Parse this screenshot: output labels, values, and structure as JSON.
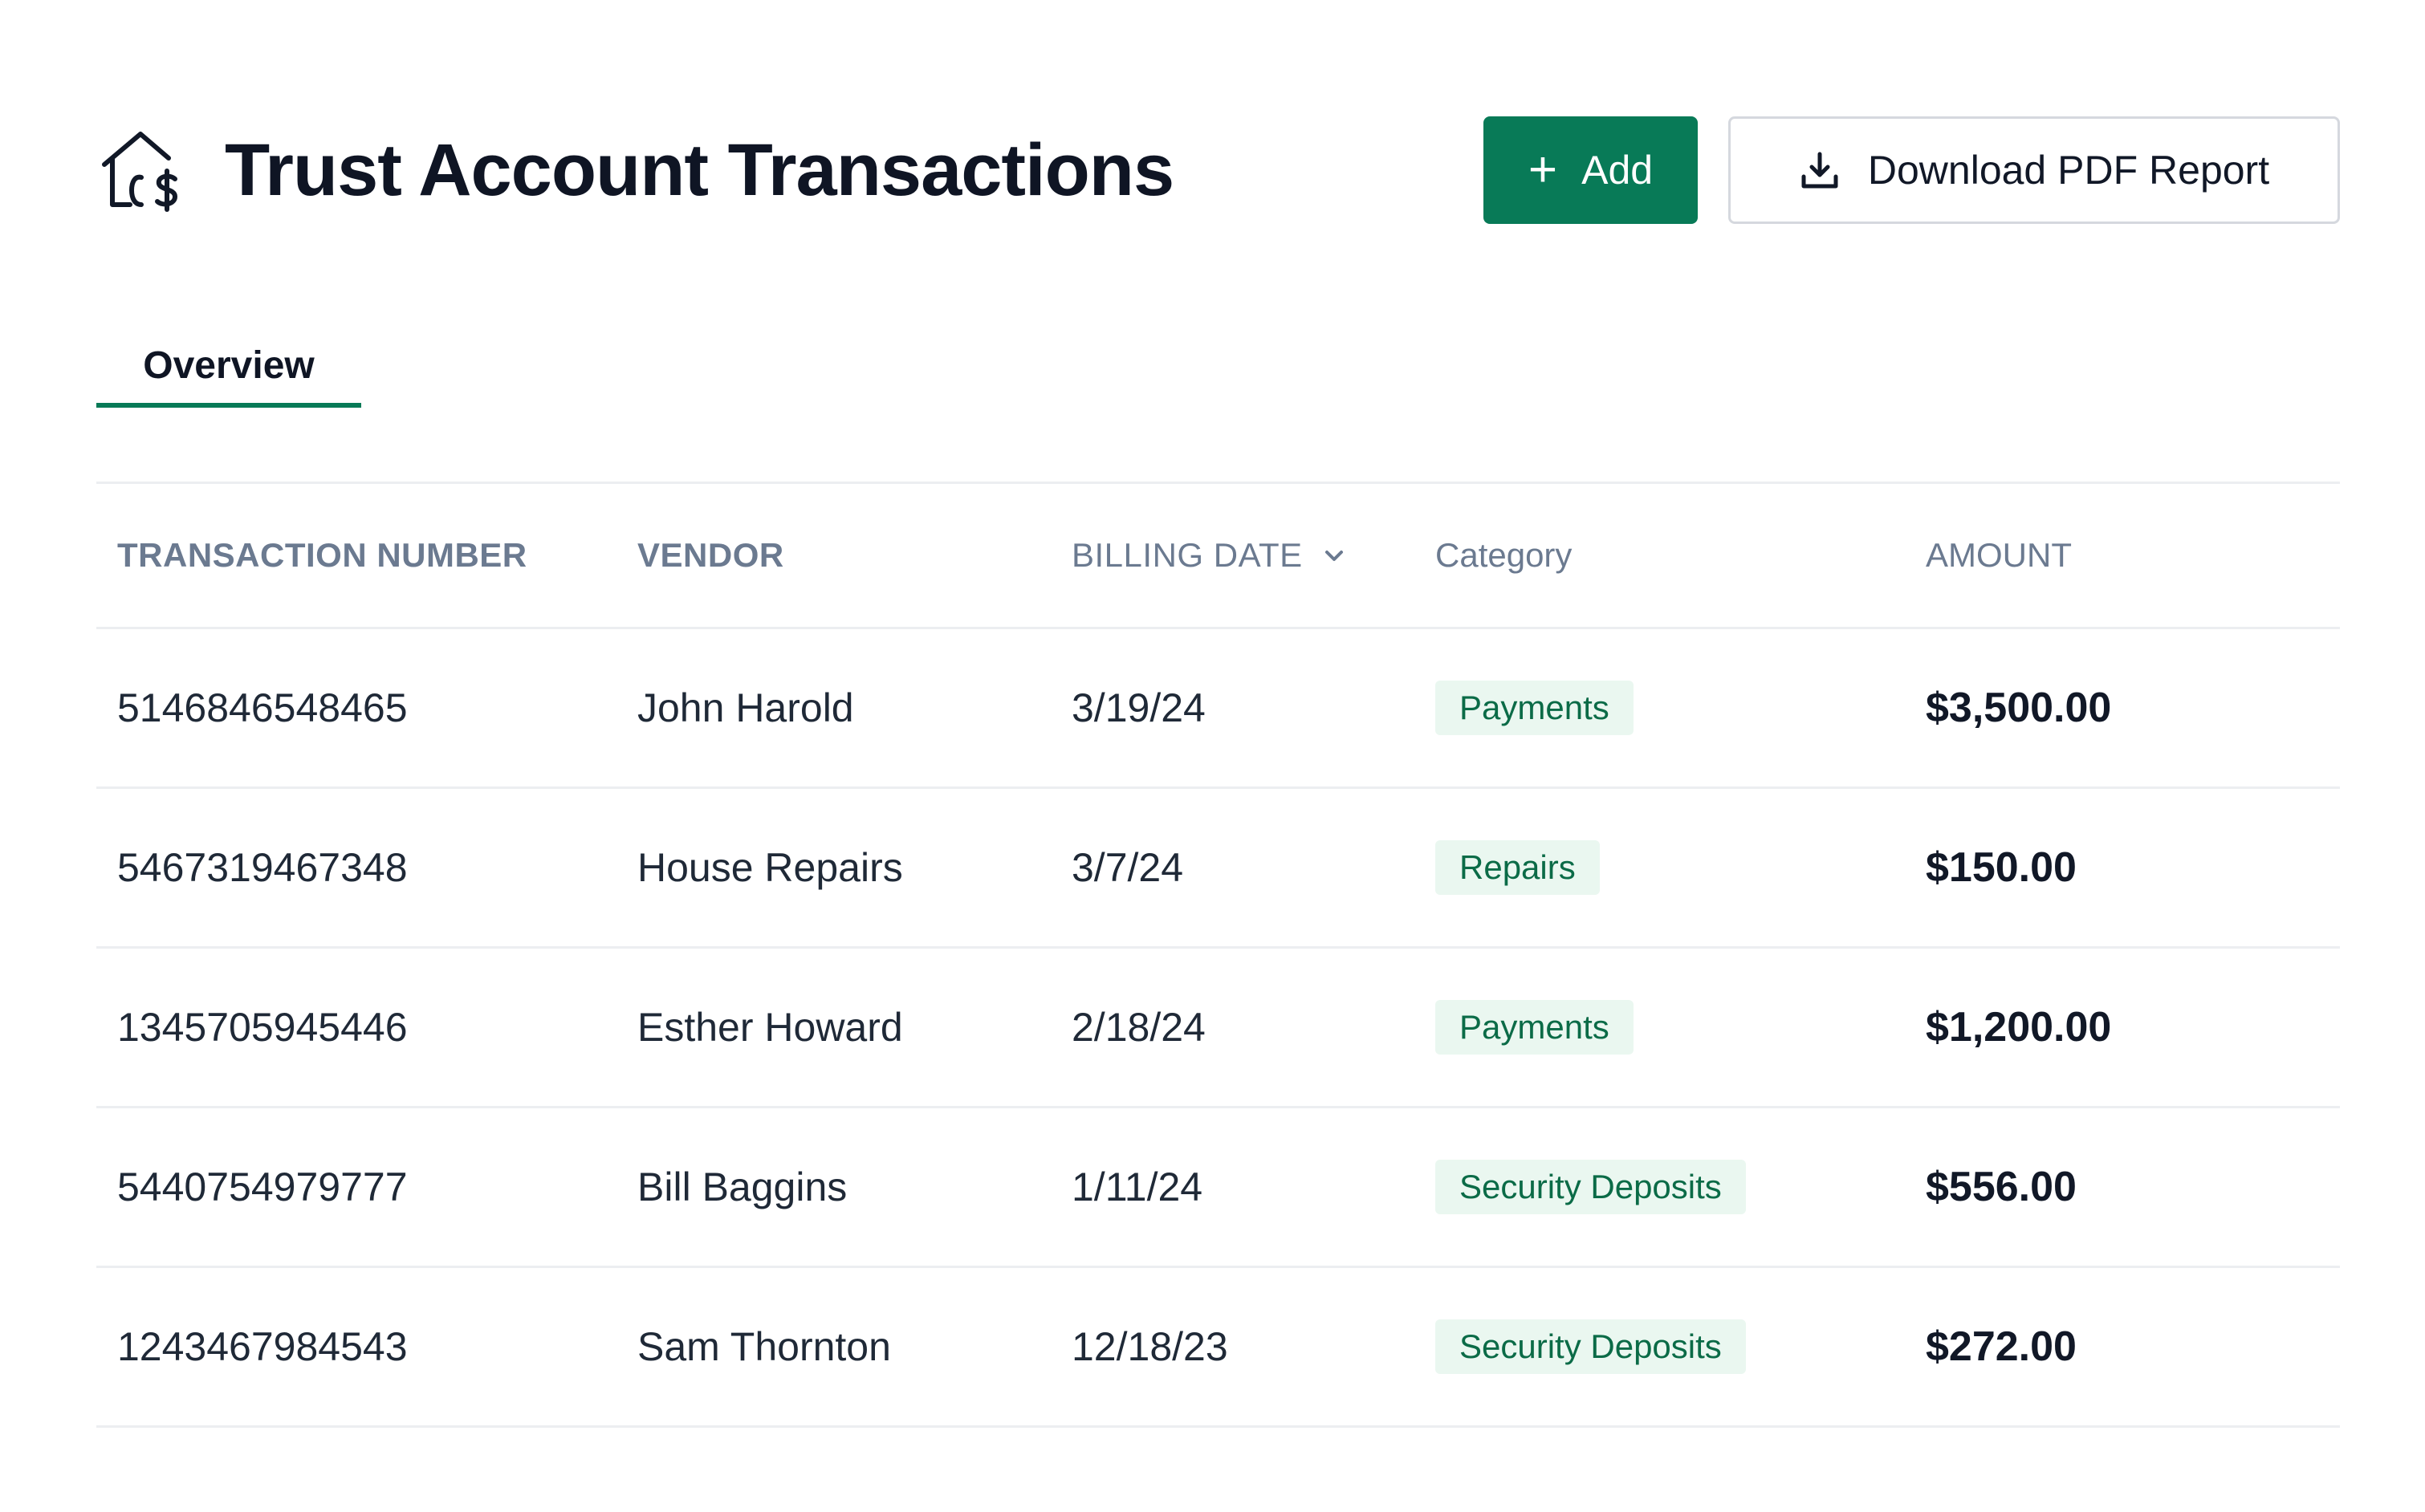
{
  "header": {
    "brand_icon": "house-dollar-icon",
    "title": "Trust Account Transactions",
    "add_label": "Add",
    "add_icon": "plus-icon",
    "download_label": "Download PDF Report",
    "download_icon": "download-icon"
  },
  "tabs": [
    {
      "label": "Overview",
      "active": true
    }
  ],
  "table": {
    "columns": {
      "transaction_number": "TRANSACTION NUMBER",
      "vendor": "VENDOR",
      "billing_date": "BILLING DATE",
      "category": "Category",
      "amount": "AMOUNT"
    },
    "sort_icon": "chevron-down-icon",
    "rows": [
      {
        "number": "5146846548465",
        "vendor": "John Harold",
        "date": "3/19/24",
        "category": "Payments",
        "amount": "$3,500.00"
      },
      {
        "number": "5467319467348",
        "vendor": "House Repairs",
        "date": "3/7/24",
        "category": "Repairs",
        "amount": "$150.00"
      },
      {
        "number": "1345705945446",
        "vendor": "Esther Howard",
        "date": "2/18/24",
        "category": "Payments",
        "amount": "$1,200.00"
      },
      {
        "number": "5440754979777",
        "vendor": "Bill Baggins",
        "date": "1/11/24",
        "category": "Security Deposits",
        "amount": "$556.00"
      },
      {
        "number": "1243467984543",
        "vendor": "Sam Thornton",
        "date": "12/18/23",
        "category": "Security Deposits",
        "amount": "$272.00"
      }
    ]
  },
  "colors": {
    "accent": "#087a57",
    "badge_bg": "#eaf7f0",
    "badge_text": "#0b6b47",
    "header_text": "#6b7a90"
  }
}
